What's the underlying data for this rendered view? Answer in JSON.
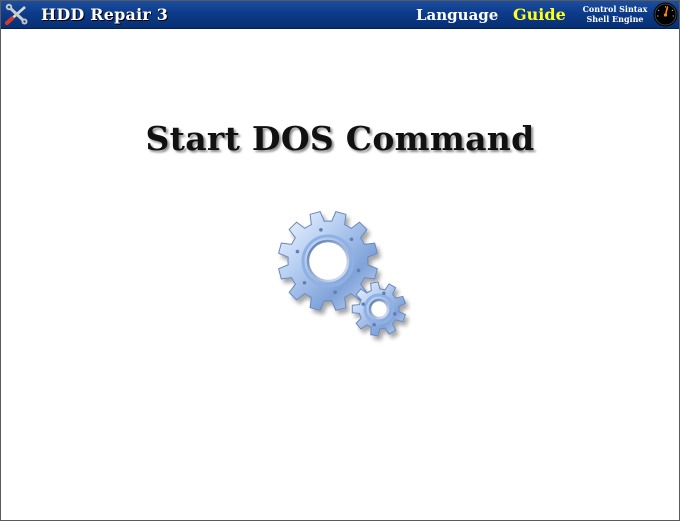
{
  "header": {
    "app_title": "HDD Repair 3",
    "menu_language": "Language",
    "menu_guide": "Guide",
    "engine_line1": "Control Sintax",
    "engine_line2": "Shell Engine",
    "app_icon": "tools-wrench-screwdriver-icon",
    "engine_icon": "gauge-dial-icon"
  },
  "main": {
    "title": "Start DOS Command",
    "action_icon": "gears-icon"
  },
  "colors": {
    "titlebar": "#0d3b8a",
    "guide_accent": "#ffff1e",
    "title_text": "#111111"
  }
}
